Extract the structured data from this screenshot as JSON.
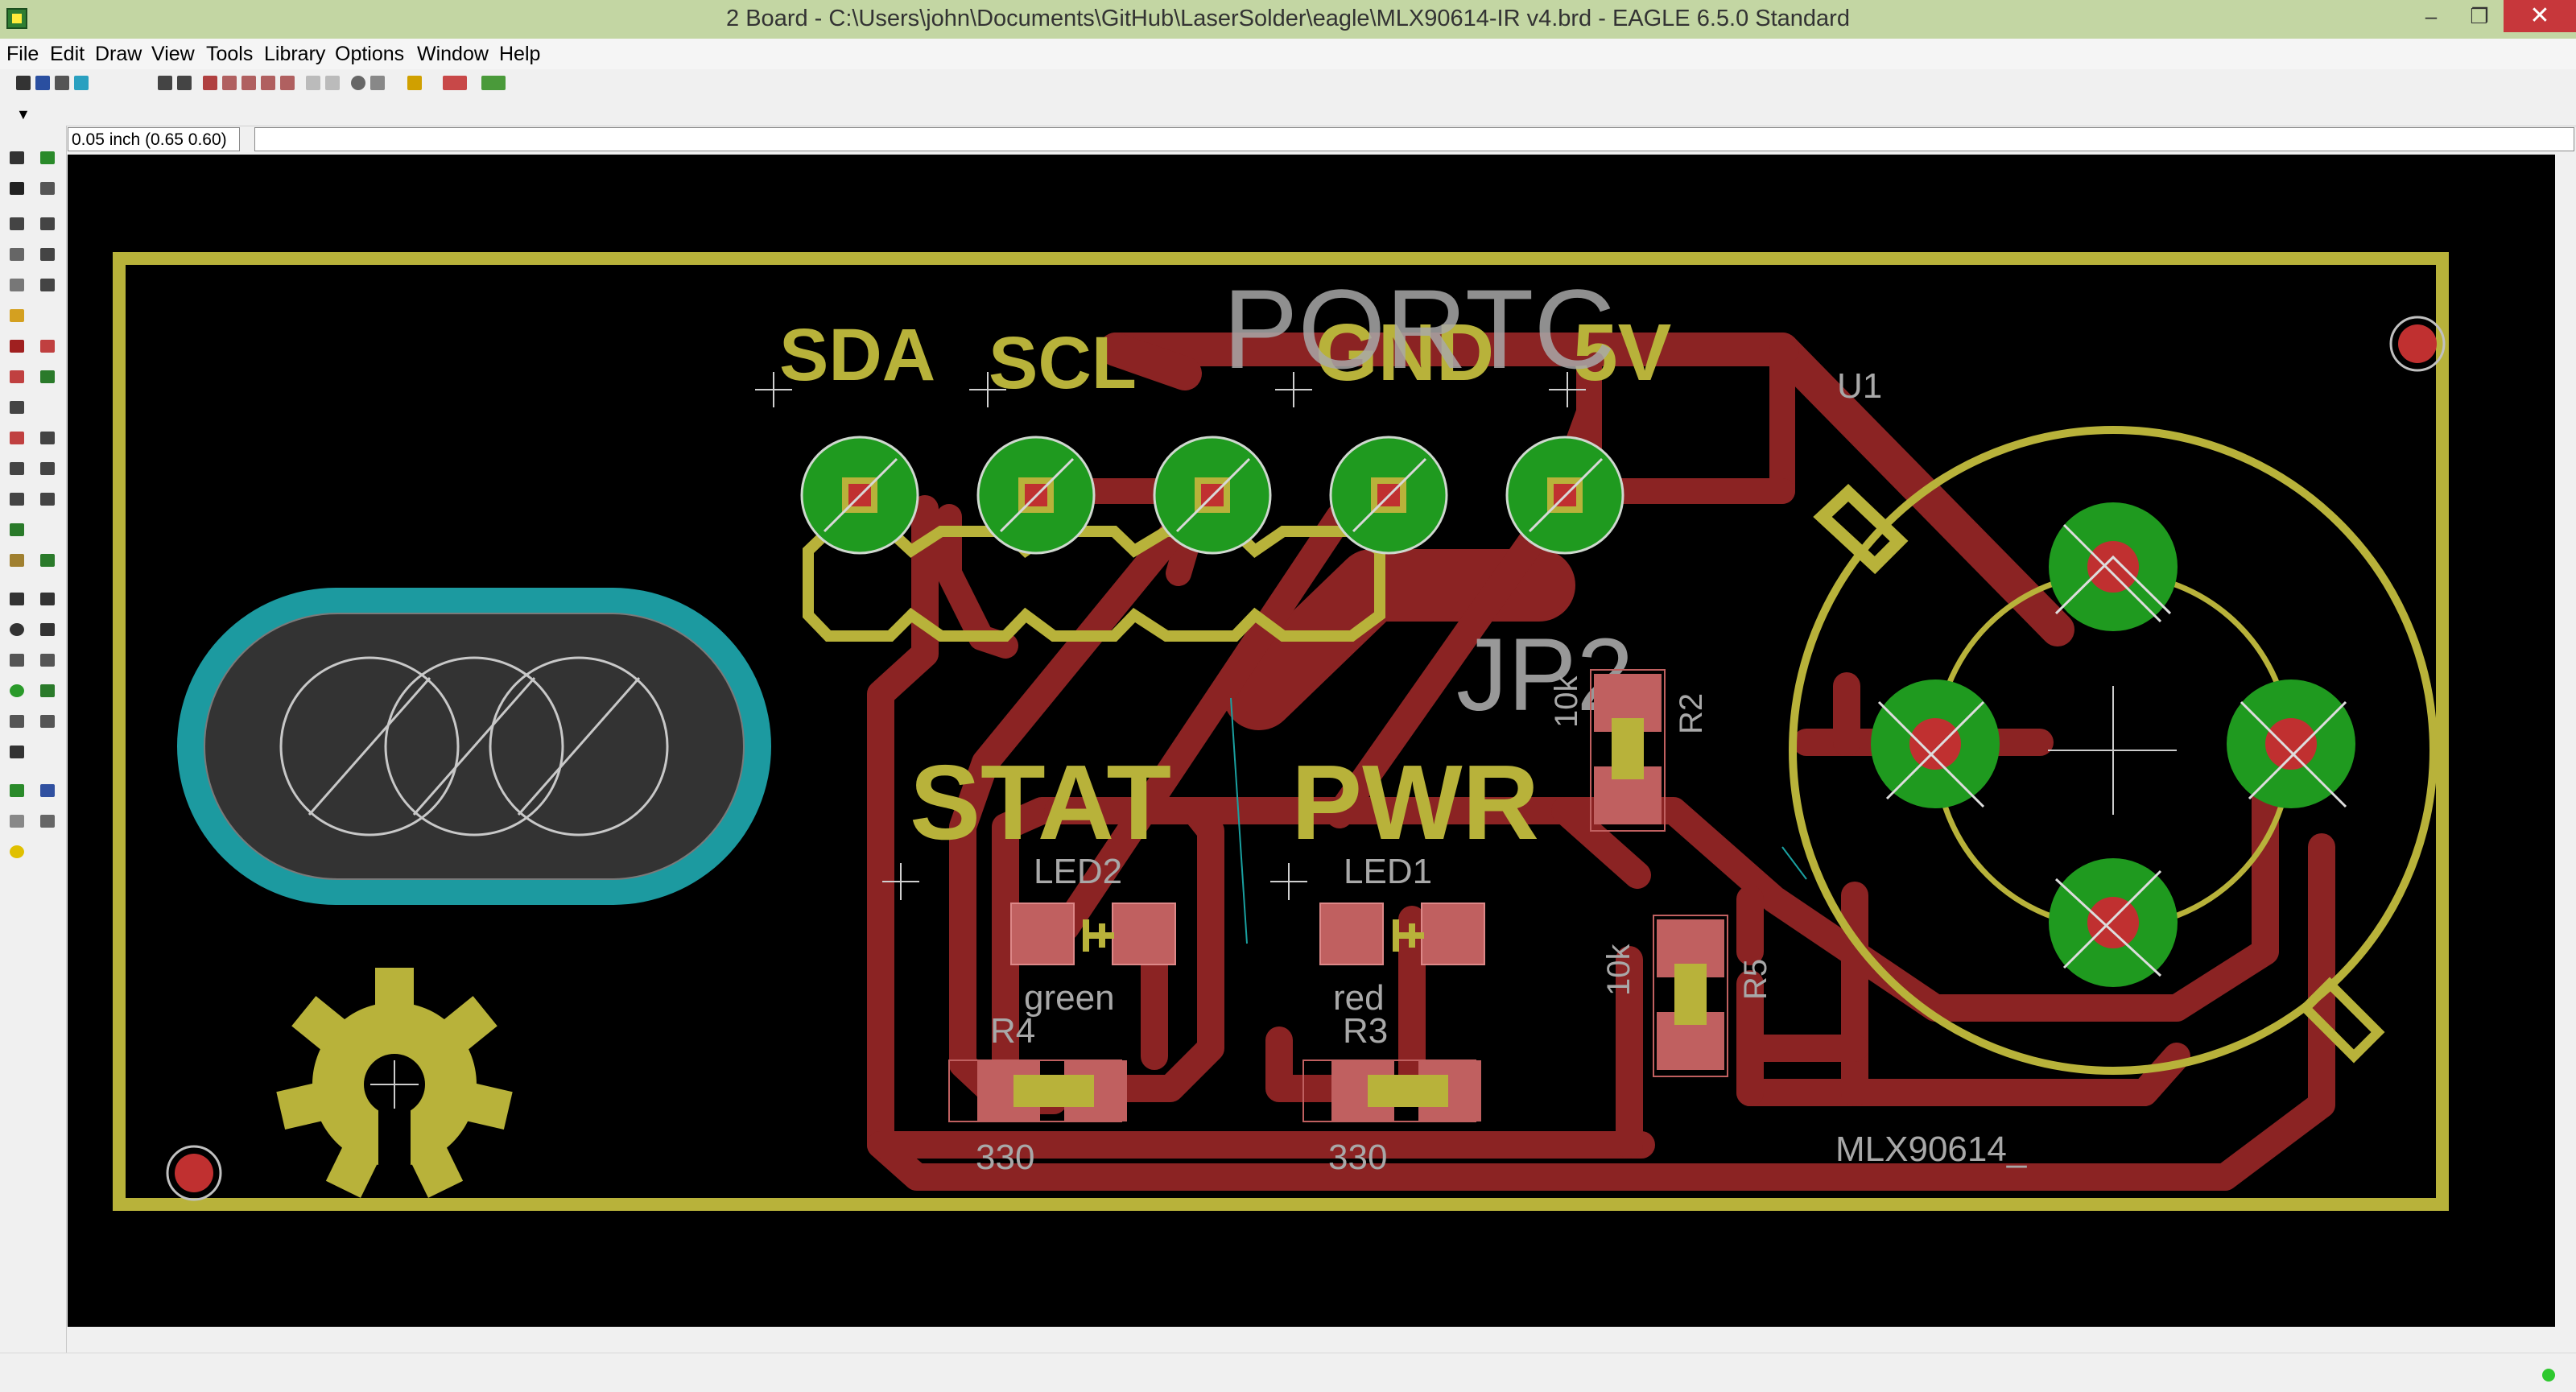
{
  "window": {
    "title": "2 Board - C:\\Users\\john\\Documents\\GitHub\\LaserSolder\\eagle\\MLX90614-IR v4.brd - EAGLE 6.5.0 Standard",
    "minimize": "–",
    "maximize": "❐",
    "close": "✕"
  },
  "menu": [
    "File",
    "Edit",
    "Draw",
    "View",
    "Tools",
    "Library",
    "Options",
    "Window",
    "Help"
  ],
  "command": {
    "coordinate": "0.05 inch (0.65 0.60)",
    "input_value": ""
  },
  "board": {
    "header_label": "PORTC",
    "pin_labels": [
      "SDA",
      "SCL",
      "GND",
      "5V"
    ],
    "connector_name": "JP2",
    "stat_label": "STAT",
    "pwr_label": "PWR",
    "led2": {
      "name": "LED2",
      "value": "green"
    },
    "led1": {
      "name": "LED1",
      "value": "red"
    },
    "r4": {
      "name": "R4",
      "value": "330"
    },
    "r3": {
      "name": "R3",
      "value": "330"
    },
    "r2": {
      "name": "R2",
      "value": "10k"
    },
    "r5": {
      "name": "R5",
      "value": "10k"
    },
    "sensor": {
      "name": "U1",
      "value": "MLX90614_"
    }
  },
  "colors": {
    "copper_top": "#8b2323",
    "silkscreen": "#b8b23a",
    "pad": "#1f9a1f",
    "drill": "#c03030",
    "board_outline": "#b8b23a",
    "names": "#a8a8a8"
  }
}
